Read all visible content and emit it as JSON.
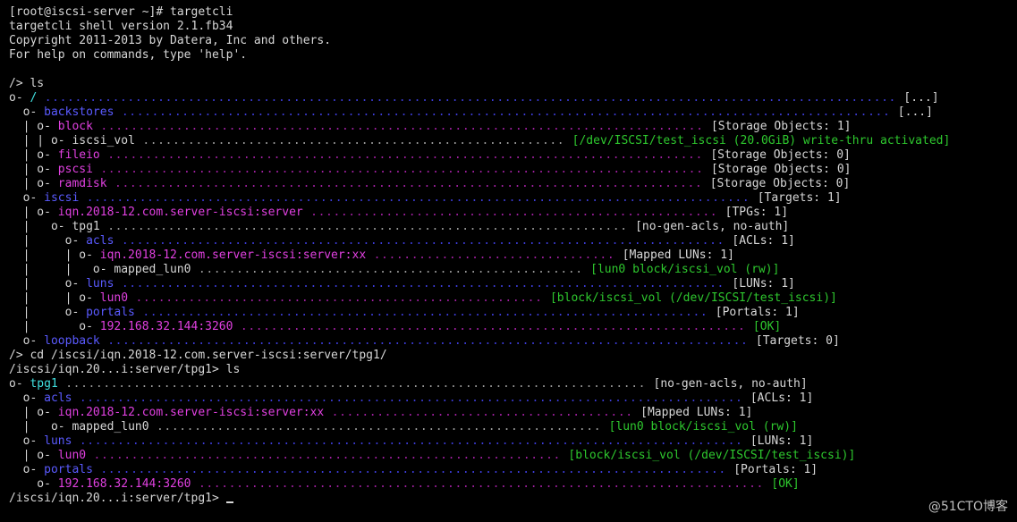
{
  "colors": {
    "background": "#000000",
    "text": "#d7d7d7",
    "blue": "#5a5aff",
    "magenta": "#e040e0",
    "green": "#2ec82e",
    "cyan": "#40e0e0"
  },
  "watermark": "@51CTO博客",
  "lines": [
    [
      {
        "t": "[root@iscsi-server ~]# targetcli",
        "c": "white"
      }
    ],
    [
      {
        "t": "targetcli shell version 2.1.fb34",
        "c": "white"
      }
    ],
    [
      {
        "t": "Copyright 2011-2013 by Datera, Inc and others.",
        "c": "white"
      }
    ],
    [
      {
        "t": "For help on commands, type 'help'.",
        "c": "white"
      }
    ],
    [],
    [
      {
        "t": "/> ls",
        "c": "white"
      }
    ],
    [
      {
        "t": "o- ",
        "c": "white"
      },
      {
        "t": "/",
        "c": "cyan"
      },
      {
        "t": " ................................................................................................................. ",
        "c": "blue-d"
      },
      {
        "t": "[...]",
        "c": "white"
      }
    ],
    [
      {
        "t": "  o- ",
        "c": "white"
      },
      {
        "t": "backstores",
        "c": "blue"
      },
      {
        "t": " ...................................................................................................... ",
        "c": "blue-d"
      },
      {
        "t": "[...]",
        "c": "white"
      }
    ],
    [
      {
        "t": "  | o- ",
        "c": "white"
      },
      {
        "t": "block",
        "c": "mag"
      },
      {
        "t": " ................................................................................ ",
        "c": "mag-d"
      },
      {
        "t": "[Storage Objects: 1]",
        "c": "white"
      }
    ],
    [
      {
        "t": "  | | o- ",
        "c": "white"
      },
      {
        "t": "iscsi_vol",
        "c": "white"
      },
      {
        "t": " ........................................................ ",
        "c": "dim"
      },
      {
        "t": "[/dev/ISCSI/test_iscsi (20.0GiB) write-thru activated]",
        "c": "green"
      }
    ],
    [
      {
        "t": "  | o- ",
        "c": "white"
      },
      {
        "t": "fileio",
        "c": "mag"
      },
      {
        "t": " ............................................................................... ",
        "c": "mag-d"
      },
      {
        "t": "[Storage Objects: 0]",
        "c": "white"
      }
    ],
    [
      {
        "t": "  | o- ",
        "c": "white"
      },
      {
        "t": "pscsi",
        "c": "mag"
      },
      {
        "t": " ................................................................................ ",
        "c": "mag-d"
      },
      {
        "t": "[Storage Objects: 0]",
        "c": "white"
      }
    ],
    [
      {
        "t": "  | o- ",
        "c": "white"
      },
      {
        "t": "ramdisk",
        "c": "mag"
      },
      {
        "t": " .............................................................................. ",
        "c": "mag-d"
      },
      {
        "t": "[Storage Objects: 0]",
        "c": "white"
      }
    ],
    [
      {
        "t": "  o- ",
        "c": "white"
      },
      {
        "t": "iscsi",
        "c": "blue"
      },
      {
        "t": " ........................................................................................ ",
        "c": "blue-d"
      },
      {
        "t": "[Targets: 1]",
        "c": "white"
      }
    ],
    [
      {
        "t": "  | o- ",
        "c": "white"
      },
      {
        "t": "iqn.2018-12.com.server-iscsi:server",
        "c": "mag"
      },
      {
        "t": " ...................................................... ",
        "c": "mag-d"
      },
      {
        "t": "[TPGs: 1]",
        "c": "white"
      }
    ],
    [
      {
        "t": "  |   o- ",
        "c": "white"
      },
      {
        "t": "tpg1",
        "c": "white"
      },
      {
        "t": " ..................................................................... ",
        "c": "dim"
      },
      {
        "t": "[no-gen-acls, no-auth]",
        "c": "white"
      }
    ],
    [
      {
        "t": "  |     o- ",
        "c": "white"
      },
      {
        "t": "acls",
        "c": "blue"
      },
      {
        "t": " ................................................................................ ",
        "c": "blue-d"
      },
      {
        "t": "[ACLs: 1]",
        "c": "white"
      }
    ],
    [
      {
        "t": "  |     | o- ",
        "c": "white"
      },
      {
        "t": "iqn.2018-12.com.server-iscsi:server:xx",
        "c": "mag"
      },
      {
        "t": " ................................ ",
        "c": "mag-d"
      },
      {
        "t": "[Mapped LUNs: 1]",
        "c": "white"
      }
    ],
    [
      {
        "t": "  |     |   o- ",
        "c": "white"
      },
      {
        "t": "mapped_lun0",
        "c": "white"
      },
      {
        "t": " ................................................... ",
        "c": "dim"
      },
      {
        "t": "[lun0 block/iscsi_vol (rw)]",
        "c": "green"
      }
    ],
    [
      {
        "t": "  |     o- ",
        "c": "white"
      },
      {
        "t": "luns",
        "c": "blue"
      },
      {
        "t": " ................................................................................ ",
        "c": "blue-d"
      },
      {
        "t": "[LUNs: 1]",
        "c": "white"
      }
    ],
    [
      {
        "t": "  |     | o- ",
        "c": "white"
      },
      {
        "t": "lun0",
        "c": "mag"
      },
      {
        "t": " ...................................................... ",
        "c": "mag-d"
      },
      {
        "t": "[block/iscsi_vol (/dev/ISCSI/test_iscsi)]",
        "c": "green"
      }
    ],
    [
      {
        "t": "  |     o- ",
        "c": "white"
      },
      {
        "t": "portals",
        "c": "blue"
      },
      {
        "t": " ........................................................................... ",
        "c": "blue-d"
      },
      {
        "t": "[Portals: 1]",
        "c": "white"
      }
    ],
    [
      {
        "t": "  |       o- ",
        "c": "white"
      },
      {
        "t": "192.168.32.144:3260",
        "c": "mag"
      },
      {
        "t": " ................................................................... ",
        "c": "mag-d"
      },
      {
        "t": "[OK]",
        "c": "green"
      }
    ],
    [
      {
        "t": "  o- ",
        "c": "white"
      },
      {
        "t": "loopback",
        "c": "blue"
      },
      {
        "t": " ..................................................................................... ",
        "c": "blue-d"
      },
      {
        "t": "[Targets: 0]",
        "c": "white"
      }
    ],
    [
      {
        "t": "/> cd /iscsi/iqn.2018-12.com.server-iscsi:server/tpg1/",
        "c": "white"
      }
    ],
    [
      {
        "t": "/iscsi/iqn.20...i:server/tpg1> ls",
        "c": "white"
      }
    ],
    [
      {
        "t": "o- ",
        "c": "white"
      },
      {
        "t": "tpg1",
        "c": "cyan"
      },
      {
        "t": " ............................................................................. ",
        "c": "dim"
      },
      {
        "t": "[no-gen-acls, no-auth]",
        "c": "white"
      }
    ],
    [
      {
        "t": "  o- ",
        "c": "white"
      },
      {
        "t": "acls",
        "c": "blue"
      },
      {
        "t": " ........................................................................................ ",
        "c": "blue-d"
      },
      {
        "t": "[ACLs: 1]",
        "c": "white"
      }
    ],
    [
      {
        "t": "  | o- ",
        "c": "white"
      },
      {
        "t": "iqn.2018-12.com.server-iscsi:server:xx",
        "c": "mag"
      },
      {
        "t": " ........................................ ",
        "c": "mag-d"
      },
      {
        "t": "[Mapped LUNs: 1]",
        "c": "white"
      }
    ],
    [
      {
        "t": "  |   o- ",
        "c": "white"
      },
      {
        "t": "mapped_lun0",
        "c": "white"
      },
      {
        "t": " ........................................................... ",
        "c": "dim"
      },
      {
        "t": "[lun0 block/iscsi_vol (rw)]",
        "c": "green"
      }
    ],
    [
      {
        "t": "  o- ",
        "c": "white"
      },
      {
        "t": "luns",
        "c": "blue"
      },
      {
        "t": " ........................................................................................ ",
        "c": "blue-d"
      },
      {
        "t": "[LUNs: 1]",
        "c": "white"
      }
    ],
    [
      {
        "t": "  | o- ",
        "c": "white"
      },
      {
        "t": "lun0",
        "c": "mag"
      },
      {
        "t": " .............................................................. ",
        "c": "mag-d"
      },
      {
        "t": "[block/iscsi_vol (/dev/ISCSI/test_iscsi)]",
        "c": "green"
      }
    ],
    [
      {
        "t": "  o- ",
        "c": "white"
      },
      {
        "t": "portals",
        "c": "blue"
      },
      {
        "t": " ................................................................................... ",
        "c": "blue-d"
      },
      {
        "t": "[Portals: 1]",
        "c": "white"
      }
    ],
    [
      {
        "t": "    o- ",
        "c": "white"
      },
      {
        "t": "192.168.32.144:3260",
        "c": "mag"
      },
      {
        "t": " ........................................................................... ",
        "c": "mag-d"
      },
      {
        "t": "[OK]",
        "c": "green"
      }
    ],
    [
      {
        "t": "/iscsi/iqn.20...i:server/tpg1> ",
        "c": "white"
      },
      {
        "cursor": true
      }
    ]
  ]
}
